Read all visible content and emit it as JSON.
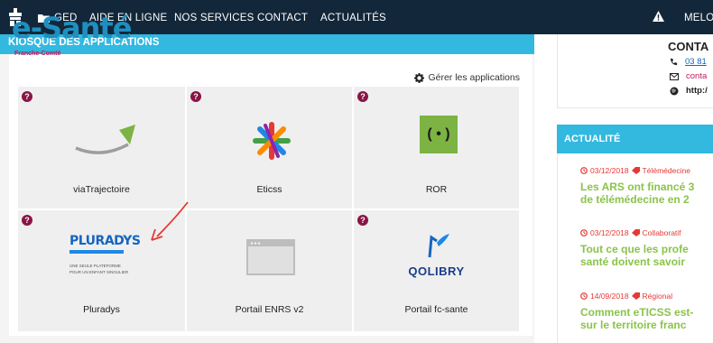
{
  "nav": {
    "items": [
      "GED",
      "AIDE EN LIGNE",
      "NOS SERVICES",
      "CONTACT",
      "ACTUALITÉS"
    ],
    "user": "MELO"
  },
  "kiosk": {
    "title": "KIOSQUE DES APPLICATIONS",
    "manage_label": "Gérer les applications",
    "apps": [
      {
        "label": "viaTrajectoire",
        "help": true
      },
      {
        "label": "Eticss",
        "help": true
      },
      {
        "label": "ROR",
        "help": true
      },
      {
        "label": "Pluradys",
        "help": true
      },
      {
        "label": "Portail ENRS v2",
        "help": false
      },
      {
        "label": "Portail fc-sante",
        "help": true
      }
    ],
    "ror_logo": "( • )",
    "pluradys_logo": "PLURADYS",
    "pluradys_tagline1": "UNE SEULE PLATEFORME",
    "pluradys_tagline2": "POUR UN ENFANT SINGULIER",
    "qolibry_logo": "QOLIBRY"
  },
  "contact": {
    "logo": "e-Santé",
    "logo_sub": "Franche-Comté",
    "title": "CONTA",
    "phone": "03 81",
    "email": "conta",
    "web": "http:/"
  },
  "news": {
    "title": "ACTUALITÉ",
    "items": [
      {
        "date": "03/12/2018",
        "tag": "Télémédecine",
        "line1": "Les ARS ont financé 3",
        "line2": "de télémédecine en 2"
      },
      {
        "date": "03/12/2018",
        "tag": "Collaboratif",
        "line1": "Tout ce que les profe",
        "line2": "santé doivent savoir"
      },
      {
        "date": "14/09/2018",
        "tag": "Régional",
        "line1": "Comment eTICSS est-",
        "line2": "sur le territoire franc"
      }
    ]
  },
  "colors": {
    "nav_bg": "#13273a",
    "accent": "#33b8e0",
    "help_badge": "#8a1446",
    "news_red": "#e53935",
    "news_green": "#8bc34a",
    "brand_blue": "#1e8fbf"
  }
}
